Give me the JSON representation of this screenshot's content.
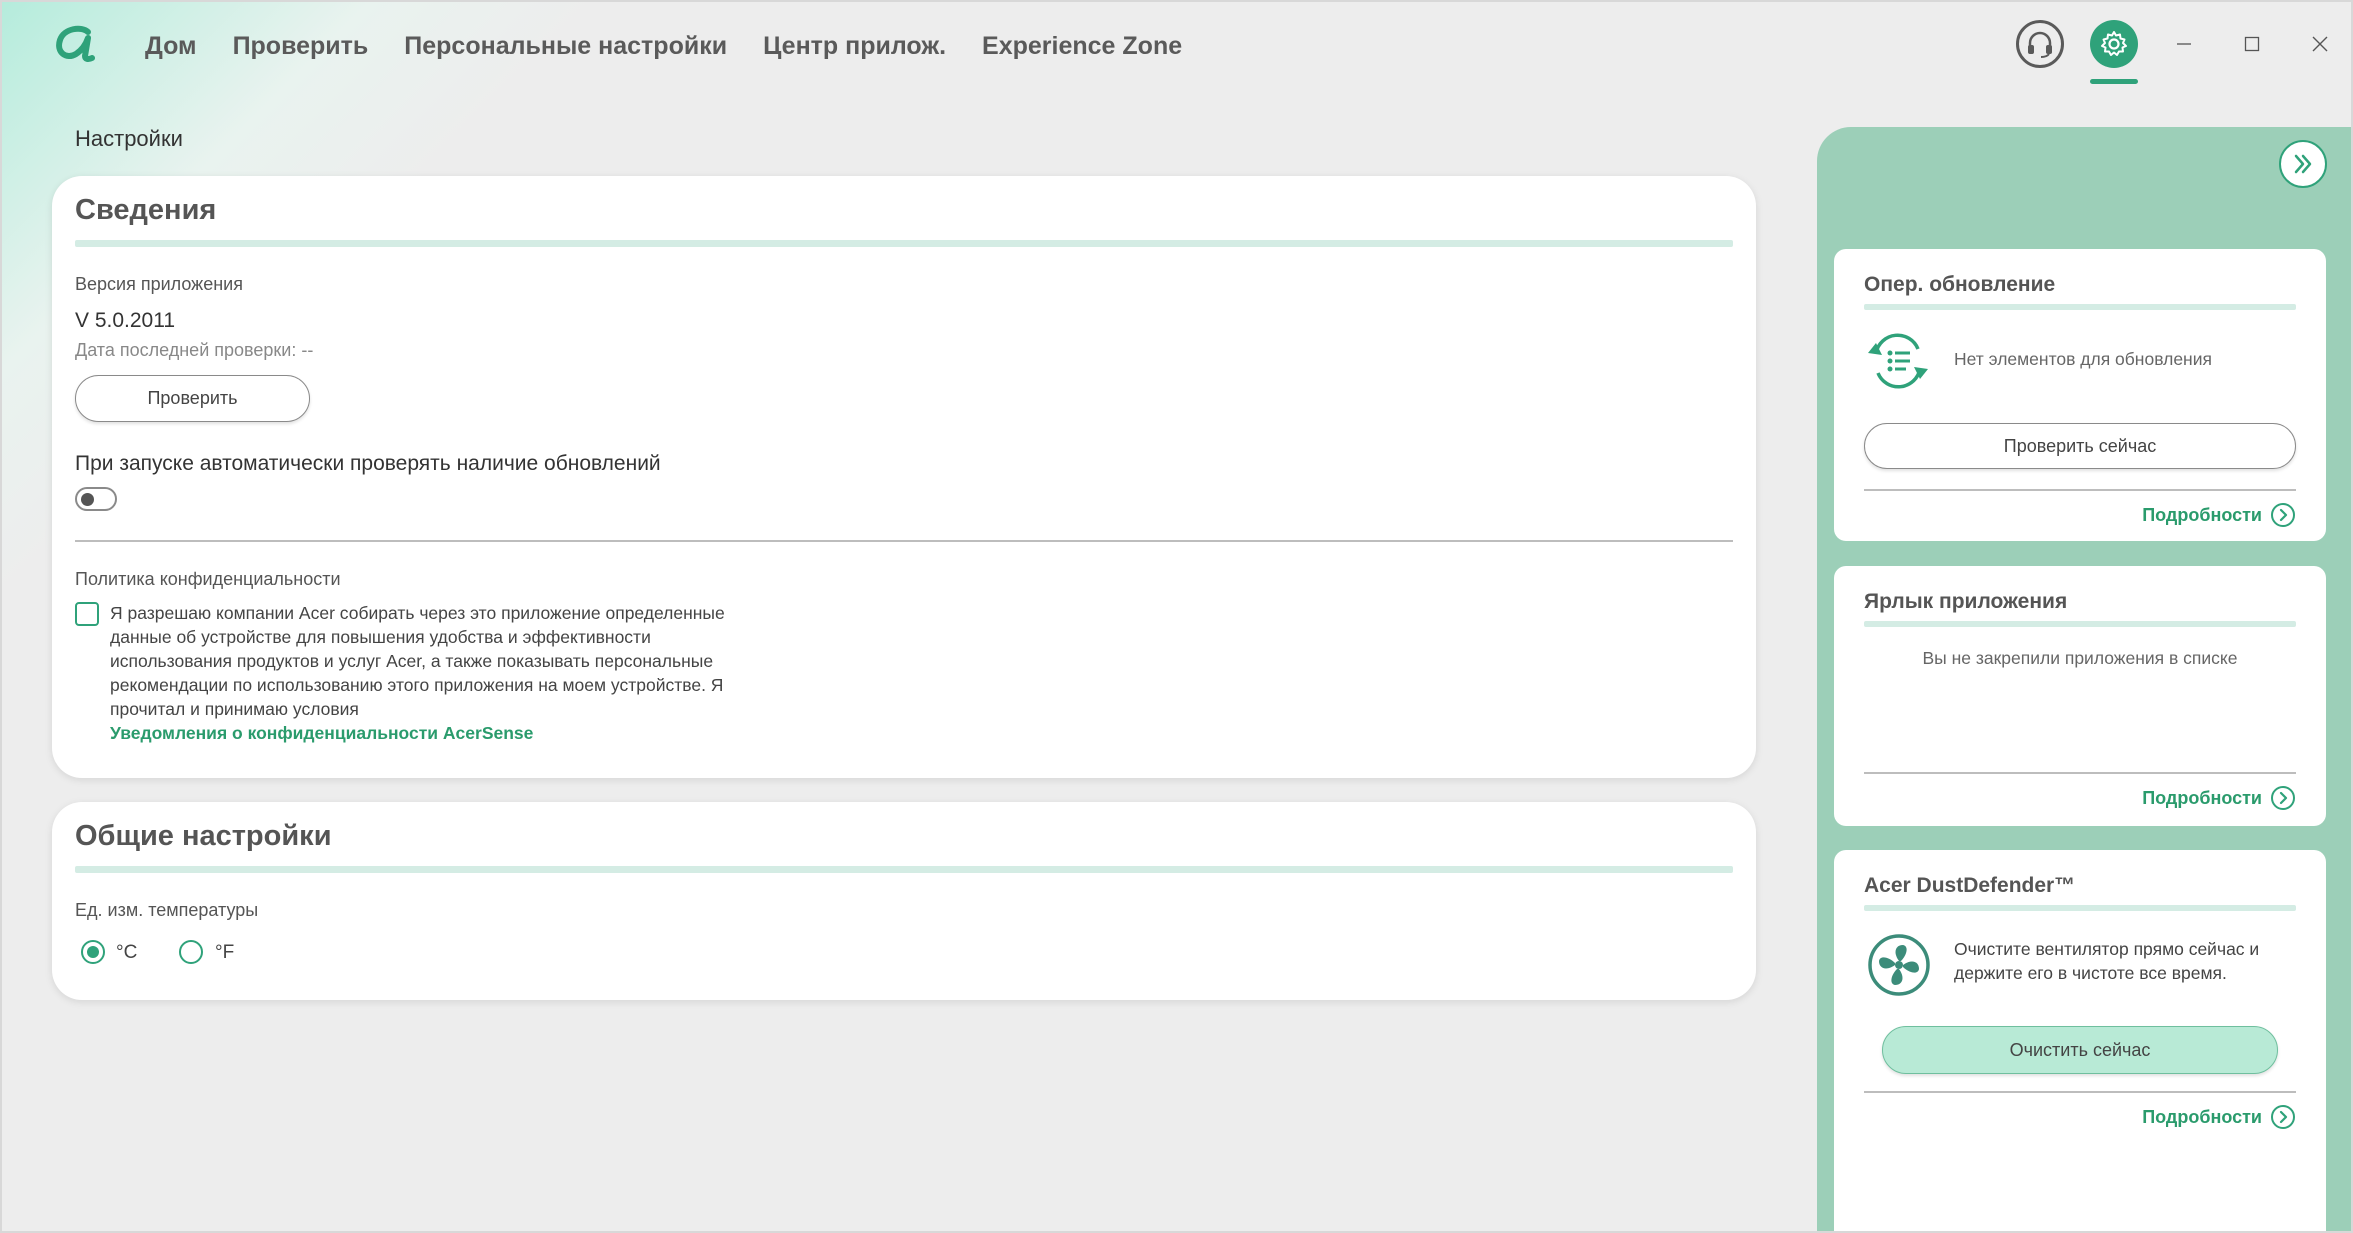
{
  "nav": {
    "items": [
      {
        "label": "Дом"
      },
      {
        "label": "Проверить"
      },
      {
        "label": "Персональные настройки"
      },
      {
        "label": "Центр прилож."
      },
      {
        "label": "Experience Zone"
      }
    ],
    "active": "settings"
  },
  "breadcrumb": "Настройки",
  "info": {
    "title": "Сведения",
    "version_label": "Версия приложения",
    "version_value": "V 5.0.2011",
    "last_check": "Дата последней проверки: --",
    "check_button": "Проверить",
    "auto_check_label": "При запуске автоматически проверять наличие обновлений",
    "auto_check_enabled": false,
    "privacy_label": "Политика конфиденциальности",
    "privacy_checked": false,
    "privacy_text": "Я разрешаю компании Acer собирать через это приложение определенные данные об устройстве для повышения удобства и эффективности использования продуктов и услуг Acer, а также показывать персональные рекомендации по использованию этого приложения на моем устройстве. Я прочитал и принимаю условия",
    "privacy_link": "Уведомления о конфиденциальности AcerSense"
  },
  "general": {
    "title": "Общие настройки",
    "temp_label": "Ед. изм. температуры",
    "options": [
      "°C",
      "°F"
    ],
    "selected": "°C"
  },
  "side": {
    "update": {
      "title": "Опер. обновление",
      "status": "Нет элементов для обновления",
      "button": "Проверить сейчас",
      "details": "Подробности"
    },
    "shortcut": {
      "title": "Ярлык приложения",
      "empty": "Вы не закрепили приложения в списке",
      "details": "Подробности"
    },
    "dust": {
      "title": "Acer DustDefender™",
      "text": "Очистите вентилятор прямо сейчас и держите его в чистоте все время.",
      "button": "Очистить сейчас",
      "details": "Подробности"
    }
  },
  "colors": {
    "accent": "#2fa27a",
    "panel": "#9ccfb8",
    "link": "#2a9b6c"
  }
}
